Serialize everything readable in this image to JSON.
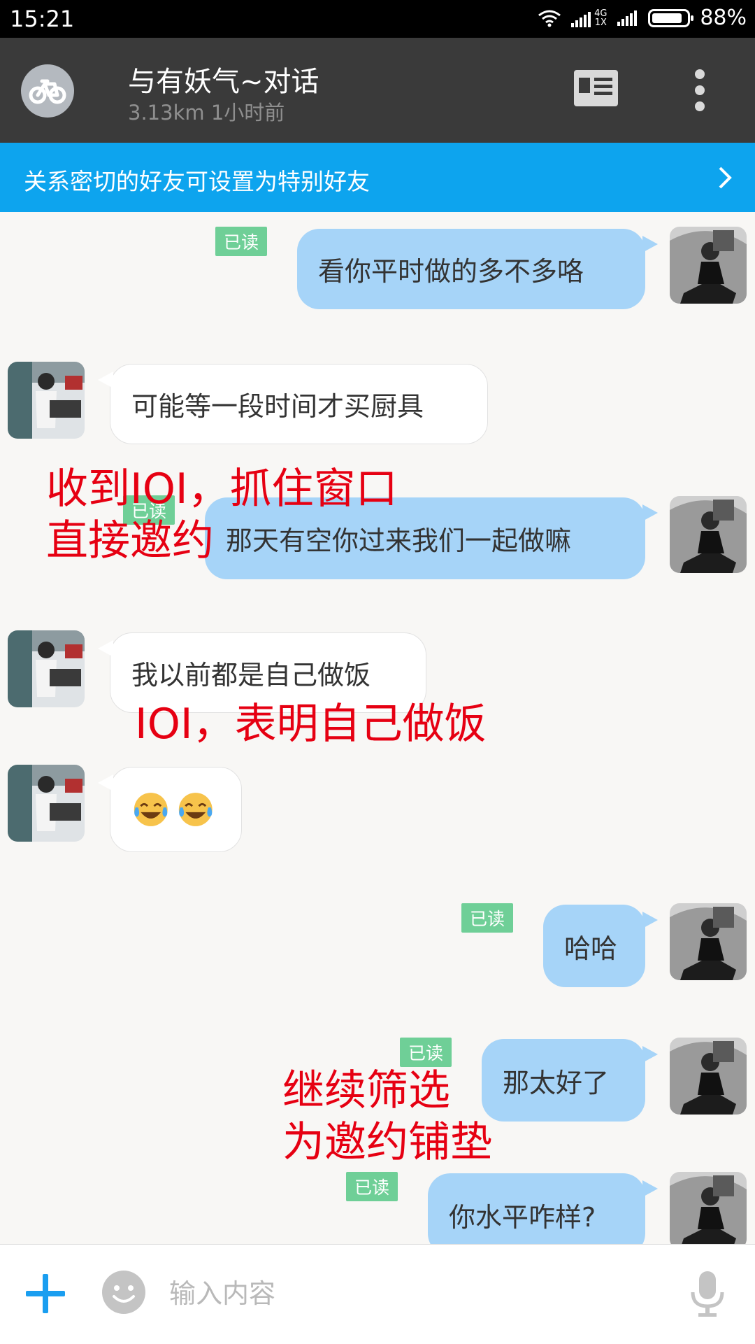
{
  "status_bar": {
    "time": "15:21",
    "network": "4G 1X",
    "battery": "88%",
    "battery_level": 0.88
  },
  "header": {
    "title": "与有妖气~对话",
    "subtitle": "3.13km 1小时前"
  },
  "banner": {
    "text": "关系密切的好友可设置为特别好友"
  },
  "messages": [
    {
      "from": "me",
      "text": "看你平时做的多不多咯",
      "status": "已读"
    },
    {
      "from": "them",
      "text": "可能等一段时间才买厨具"
    },
    {
      "from": "me",
      "text": "那天有空你过来我们一起做嘛",
      "status": "已读"
    },
    {
      "from": "them",
      "text": "我以前都是自己做饭"
    },
    {
      "from": "them",
      "text": "",
      "emoji": [
        "joy-tears-emoji",
        "joy-tears-emoji"
      ]
    },
    {
      "from": "me",
      "text": "哈哈",
      "status": "已读"
    },
    {
      "from": "me",
      "text": "那太好了",
      "status": "已读"
    },
    {
      "from": "me",
      "text": "你水平咋样?",
      "status": "已读"
    }
  ],
  "annotations": [
    "收到IOI，抓住窗口\n直接邀约",
    "IOI，表明自己做饭",
    "继续筛选\n为邀约铺垫"
  ],
  "annotation_color": "#e60012",
  "input": {
    "placeholder": "输入内容",
    "value": ""
  },
  "colors": {
    "accent": "#0da4ee",
    "my_bubble": "#a6d4f8",
    "read_badge": "#6fcf97",
    "header_bg": "#3a3a3a"
  }
}
